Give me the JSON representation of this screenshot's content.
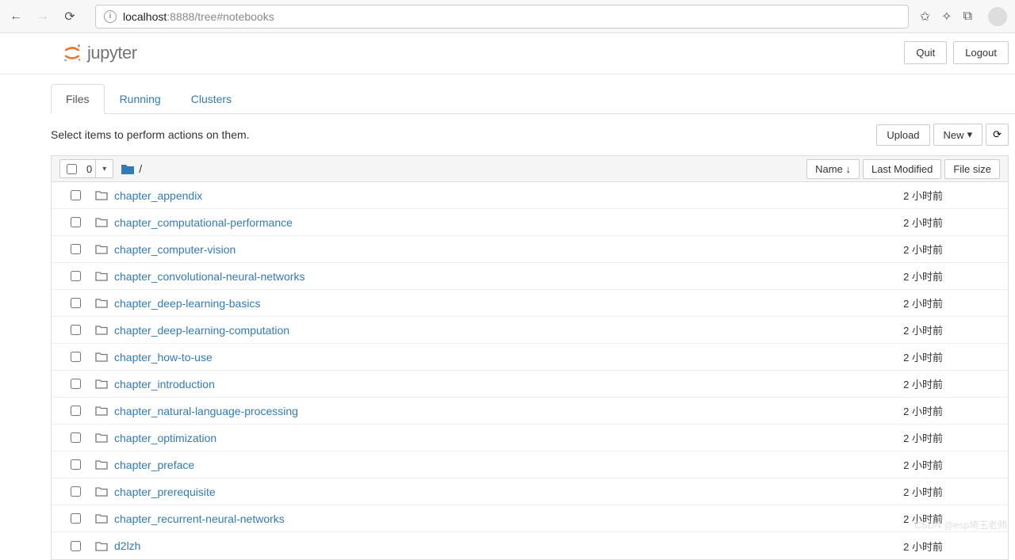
{
  "browser": {
    "url_host": "localhost",
    "url_port": ":8888",
    "url_path": "/tree#notebooks"
  },
  "header": {
    "logo_text": "jupyter",
    "quit_label": "Quit",
    "logout_label": "Logout"
  },
  "tabs": [
    {
      "label": "Files",
      "active": true
    },
    {
      "label": "Running",
      "active": false
    },
    {
      "label": "Clusters",
      "active": false
    }
  ],
  "action_bar": {
    "hint_text": "Select items to perform actions on them.",
    "upload_label": "Upload",
    "new_label": "New",
    "caret": "▾",
    "refresh_icon": "⟳"
  },
  "list_header": {
    "select_count": "0",
    "caret": "▾",
    "crumb_sep": "/",
    "sort_name": "Name",
    "sort_arrow": "↓",
    "sort_modified": "Last Modified",
    "sort_size": "File size"
  },
  "files": [
    {
      "name": "chapter_appendix",
      "modified": "2 小时前"
    },
    {
      "name": "chapter_computational-performance",
      "modified": "2 小时前"
    },
    {
      "name": "chapter_computer-vision",
      "modified": "2 小时前"
    },
    {
      "name": "chapter_convolutional-neural-networks",
      "modified": "2 小时前"
    },
    {
      "name": "chapter_deep-learning-basics",
      "modified": "2 小时前"
    },
    {
      "name": "chapter_deep-learning-computation",
      "modified": "2 小时前"
    },
    {
      "name": "chapter_how-to-use",
      "modified": "2 小时前"
    },
    {
      "name": "chapter_introduction",
      "modified": "2 小时前"
    },
    {
      "name": "chapter_natural-language-processing",
      "modified": "2 小时前"
    },
    {
      "name": "chapter_optimization",
      "modified": "2 小时前"
    },
    {
      "name": "chapter_preface",
      "modified": "2 小时前"
    },
    {
      "name": "chapter_prerequisite",
      "modified": "2 小时前"
    },
    {
      "name": "chapter_recurrent-neural-networks",
      "modified": "2 小时前"
    },
    {
      "name": "d2lzh",
      "modified": "2 小时前"
    }
  ],
  "watermark": "CSDN @esp埼玉老师"
}
